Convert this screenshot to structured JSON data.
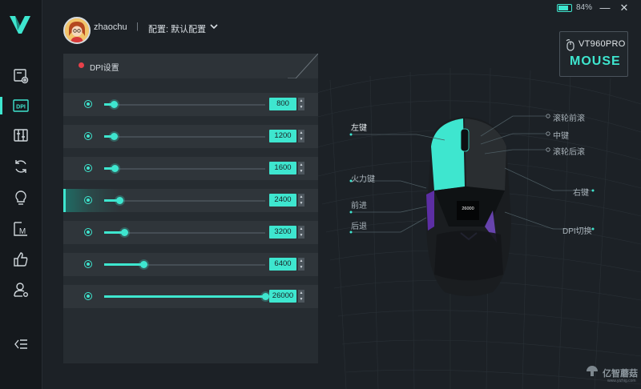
{
  "app": {
    "user": "zhaochu",
    "separator": "|",
    "profile_label": "配置: 默认配置",
    "battery": "84%",
    "battery_fraction": 0.84,
    "minimize_glyph": "—",
    "close_glyph": "✕"
  },
  "model": {
    "name": "VT960PRO",
    "type": "MOUSE"
  },
  "sidebar": {
    "items": [
      {
        "name": "sidebar-item-mouse-settings",
        "icon": "mouse-settings-icon"
      },
      {
        "name": "sidebar-item-dpi",
        "icon": "dpi-icon",
        "label": "DPI",
        "active": true
      },
      {
        "name": "sidebar-item-performance",
        "icon": "sliders-icon"
      },
      {
        "name": "sidebar-item-sync",
        "icon": "sync-icon"
      },
      {
        "name": "sidebar-item-lighting",
        "icon": "lightbulb-icon"
      },
      {
        "name": "sidebar-item-macro",
        "icon": "macro-icon",
        "label": "M"
      },
      {
        "name": "sidebar-item-like",
        "icon": "thumbs-up-icon"
      },
      {
        "name": "sidebar-item-account",
        "icon": "user-settings-icon"
      }
    ],
    "collapse_icon": "collapse-menu-icon"
  },
  "dpi_panel": {
    "title": "DPI设置",
    "max_dpi": 26000,
    "active_index": 3,
    "levels": [
      {
        "value": "800"
      },
      {
        "value": "1200"
      },
      {
        "value": "1600"
      },
      {
        "value": "2400"
      },
      {
        "value": "3200"
      },
      {
        "value": "6400"
      },
      {
        "value": "26000"
      }
    ]
  },
  "mouse_labels": {
    "left_button": "左键",
    "fire_button": "火力键",
    "forward": "前进",
    "back": "后退",
    "scroll_forward": "滚轮前滚",
    "middle_button": "中键",
    "scroll_back": "滚轮后滚",
    "right_button": "右键",
    "dpi_switch": "DPI切换",
    "screen_dpi": "26000"
  },
  "watermark": {
    "text": "亿智蘑菇",
    "sub": "www.yizhig.com"
  },
  "colors": {
    "accent": "#3ee6cf",
    "record_dot": "#e8414a"
  }
}
